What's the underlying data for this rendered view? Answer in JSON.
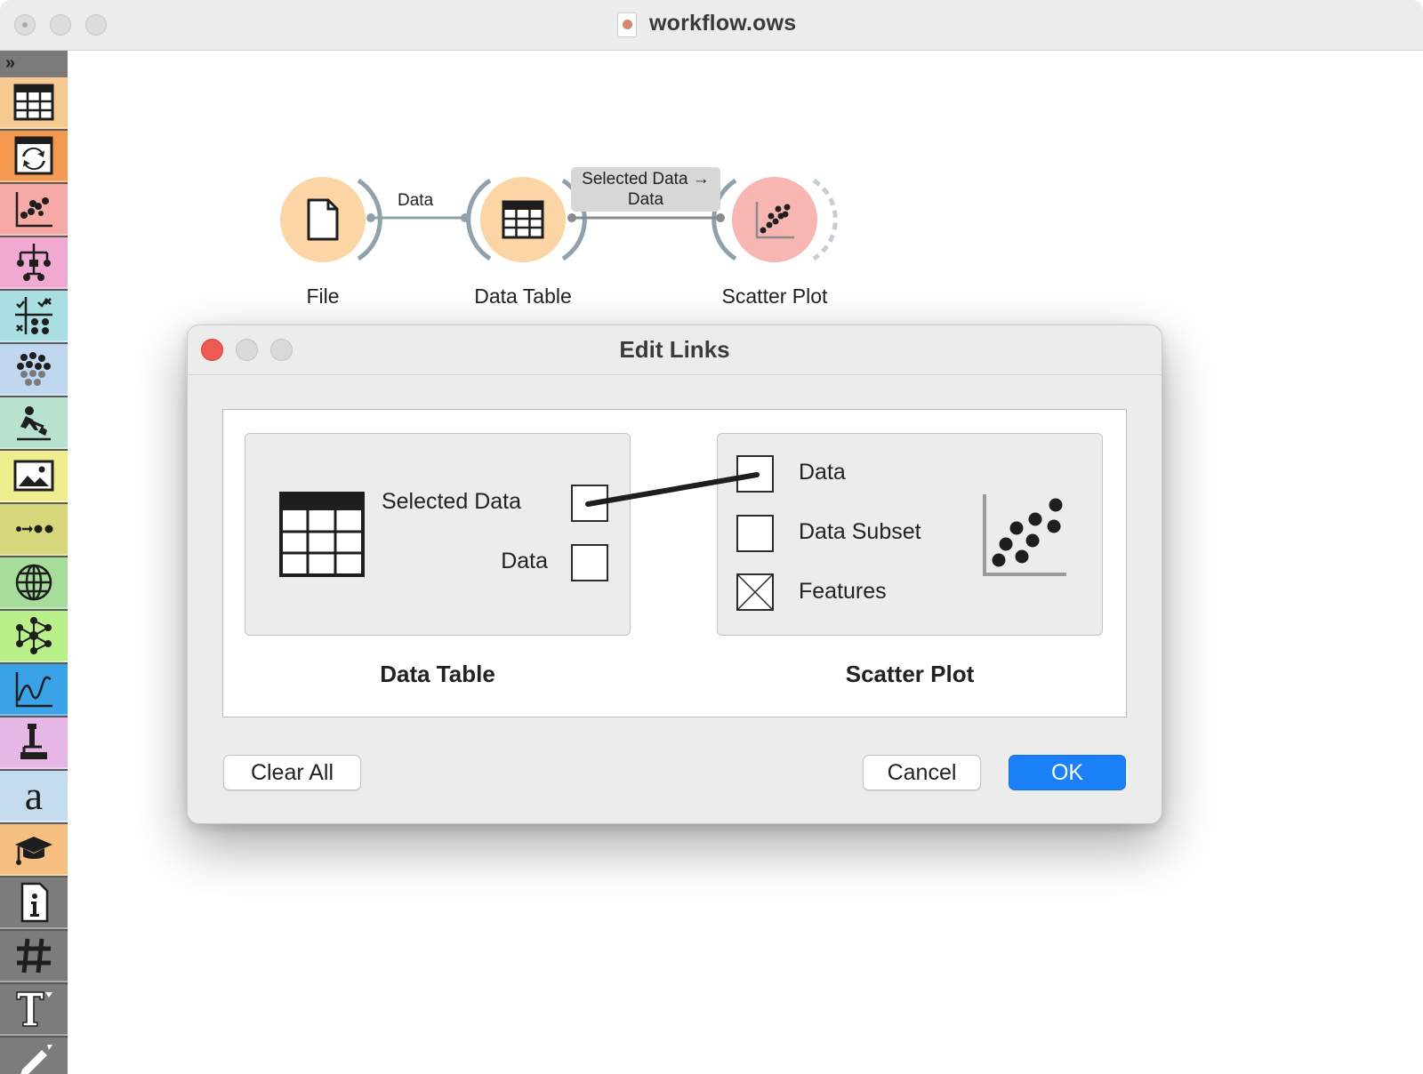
{
  "window": {
    "title": "workflow.ows"
  },
  "sidebar": {
    "toggle_glyph": "»",
    "categories": [
      {
        "name": "data",
        "icon": "table-icon",
        "color": "#f5c98f"
      },
      {
        "name": "transform",
        "icon": "transform-icon",
        "color": "#f39a50"
      },
      {
        "name": "visualize",
        "icon": "scatter-icon",
        "color": "#f7a9a6"
      },
      {
        "name": "model",
        "icon": "tree-icon",
        "color": "#f1a9d2"
      },
      {
        "name": "evaluate",
        "icon": "evaluate-icon",
        "color": "#a9dfe3"
      },
      {
        "name": "unsupervised",
        "icon": "cluster-icon",
        "color": "#bfd7ef"
      },
      {
        "name": "educational",
        "icon": "digger-icon",
        "color": "#b8e2cd"
      },
      {
        "name": "image-analytics",
        "icon": "image-icon",
        "color": "#eeee8f"
      },
      {
        "name": "time-series",
        "icon": "sequence-icon",
        "color": "#d5d77a"
      },
      {
        "name": "geo",
        "icon": "globe-icon",
        "color": "#a6dd9b"
      },
      {
        "name": "networks",
        "icon": "network-icon",
        "color": "#b9f08a"
      },
      {
        "name": "spectroscopy",
        "icon": "spectrum-icon",
        "color": "#3aa2e6"
      },
      {
        "name": "single-cell",
        "icon": "microscope-icon",
        "color": "#e6b7e6"
      },
      {
        "name": "text-mining",
        "icon": "letter-a-icon",
        "color": "#c5dcef"
      },
      {
        "name": "survival",
        "icon": "graduation-cap-icon",
        "color": "#f5c07f"
      },
      {
        "name": "info",
        "icon": "info-icon",
        "color": "#7c7c7c"
      },
      {
        "name": "grid",
        "icon": "hash-icon",
        "color": "#7c7c7c"
      },
      {
        "name": "text",
        "icon": "text-tool-icon",
        "color": "#7c7c7c"
      },
      {
        "name": "draw",
        "icon": "pen-icon",
        "color": "#7c7c7c"
      }
    ]
  },
  "canvas": {
    "nodes": {
      "file": {
        "label": "File",
        "color": "#fbd5a5"
      },
      "data_table": {
        "label": "Data Table",
        "color": "#fbd5a5"
      },
      "scatter_plot": {
        "label": "Scatter Plot",
        "color": "#f7b6b1"
      }
    },
    "links": {
      "file_to_table": "Data",
      "table_to_scatter_line1": "Selected Data →",
      "table_to_scatter_line2": "Data"
    }
  },
  "dialog": {
    "title": "Edit Links",
    "source": {
      "widget_title": "Data Table",
      "outputs": [
        "Selected Data",
        "Data"
      ]
    },
    "sink": {
      "widget_title": "Scatter Plot",
      "inputs": [
        "Data",
        "Data Subset",
        "Features"
      ]
    },
    "buttons": {
      "clear_all": "Clear All",
      "cancel": "Cancel",
      "ok": "OK"
    }
  }
}
